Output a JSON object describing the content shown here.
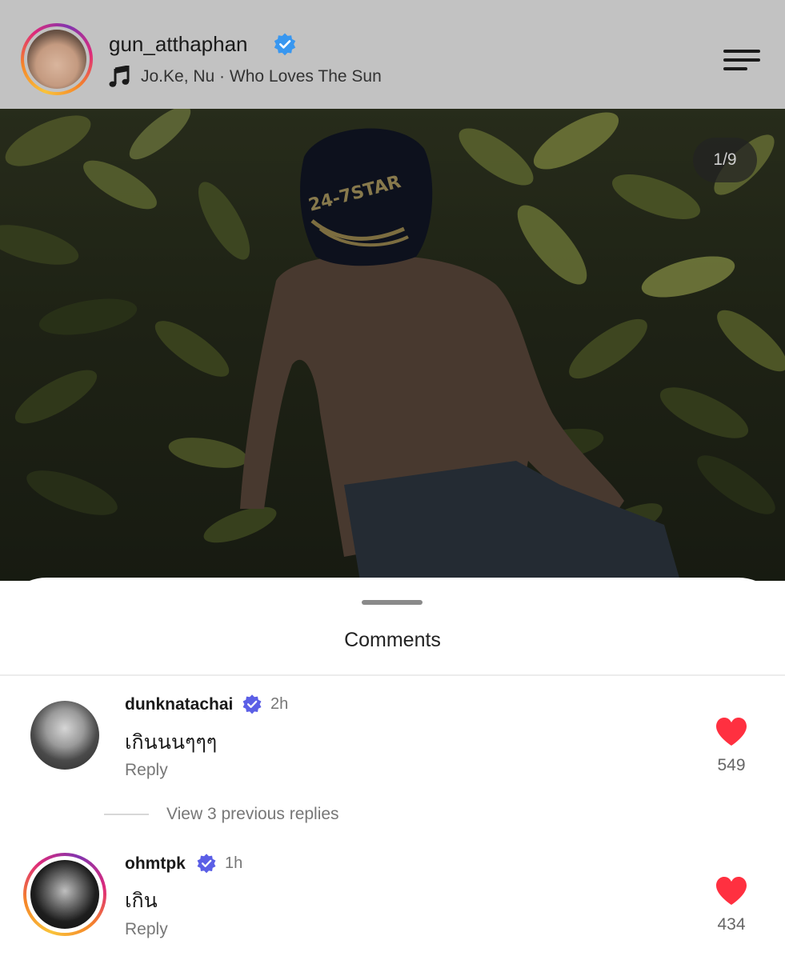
{
  "header": {
    "username": "gun_atthaphan",
    "music": "Jo.Ke, Nu · Who Loves The Sun",
    "icons": [
      "profile-avatar",
      "verified-badge",
      "music-note-icon",
      "menu-icon"
    ]
  },
  "post": {
    "counter": "1/9",
    "cap_text": "24-7STAR"
  },
  "comments_sheet": {
    "title": "Comments",
    "comments": [
      {
        "username": "dunknatachai",
        "time": "2h",
        "text": "เกินนนๆๆๆ",
        "reply_label": "Reply",
        "likes": "549"
      },
      {
        "username": "ohmtpk",
        "time": "1h",
        "text": "เกิน",
        "reply_label": "Reply",
        "likes": "434"
      }
    ],
    "view_replies": "View 3 previous replies"
  },
  "colors": {
    "verified": "#3897f0",
    "heart": "#ff3040",
    "header_bg": "#c2c2c2"
  }
}
